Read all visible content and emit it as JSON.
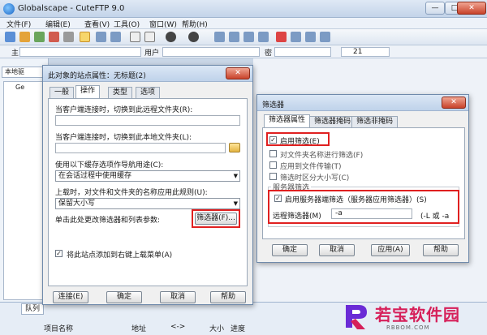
{
  "app": {
    "title": "Globalscape - CuteFTP 9.0",
    "controls": {
      "minimize": "—",
      "maximize": "□",
      "close": "✕"
    }
  },
  "menu": [
    "文件(F)",
    "编辑(E)",
    "查看(V)",
    "工具(O)",
    "窗口(W)",
    "帮助(H)"
  ],
  "address_bar": {
    "host_label": "主",
    "user_label": "用户",
    "password_label": "密",
    "port_value": "21"
  },
  "left_pane": {
    "tab_label": "本地驱",
    "tree_root": "Ge"
  },
  "queue": {
    "tab_label": "队列",
    "columns": [
      "项目名称",
      "地址",
      "<->",
      "大小",
      "进度"
    ]
  },
  "site_dialog": {
    "title": "此对象的站点属性：无标题(2)",
    "tabs": [
      "一般",
      "操作",
      "类型",
      "选项"
    ],
    "active_tab": "操作",
    "remote_folder_label": "当客户端连接时，切换到此远程文件夹(R):",
    "remote_folder_value": "",
    "local_folder_label": "当客户端连接时，切换到此本地文件夹(L):",
    "local_folder_value": "",
    "cache_label": "使用以下缓存选项作导航用途(C):",
    "cache_value": "在会话过程中使用缓存",
    "case_label": "上载时，对文件和文件夹的名称应用此规则(U):",
    "case_value": "保留大小写",
    "filter_label": "单击此处更改筛选器和列表参数:",
    "filter_button": "筛选器(F)...",
    "rightclick_label": "将此站点添加到右键上载菜单(A)",
    "rightclick_checked": true,
    "buttons": {
      "connect": "连接(E)",
      "ok": "确定",
      "cancel": "取消",
      "help": "帮助"
    }
  },
  "filter_dialog": {
    "title": "筛选器",
    "tabs": [
      "筛选器属性",
      "筛选器掩码",
      "筛选非掩码"
    ],
    "active_tab": "筛选器属性",
    "options": [
      {
        "label": "启用筛选(E)",
        "checked": true
      },
      {
        "label": "对文件夹名称进行筛选(F)",
        "checked": false
      },
      {
        "label": "应用到文件传输(T)",
        "checked": false
      },
      {
        "label": "筛选时区分大小写(C)",
        "checked": false
      }
    ],
    "server_group_label": "服务器筛选",
    "server_filter_label": "启用服务器端筛选（服务器应用筛选器）(S)",
    "server_filter_checked": true,
    "remote_filter_label": "远程筛选器(M)",
    "remote_filter_value": "-a",
    "remote_filter_hint": "(-L 或 -a",
    "buttons": {
      "ok": "确定",
      "cancel": "取消",
      "apply": "应用(A)",
      "help": "帮助"
    }
  },
  "watermark": {
    "brand": "若宝软件园",
    "site": "RBBOM.COM",
    "color": "#d6205a"
  }
}
